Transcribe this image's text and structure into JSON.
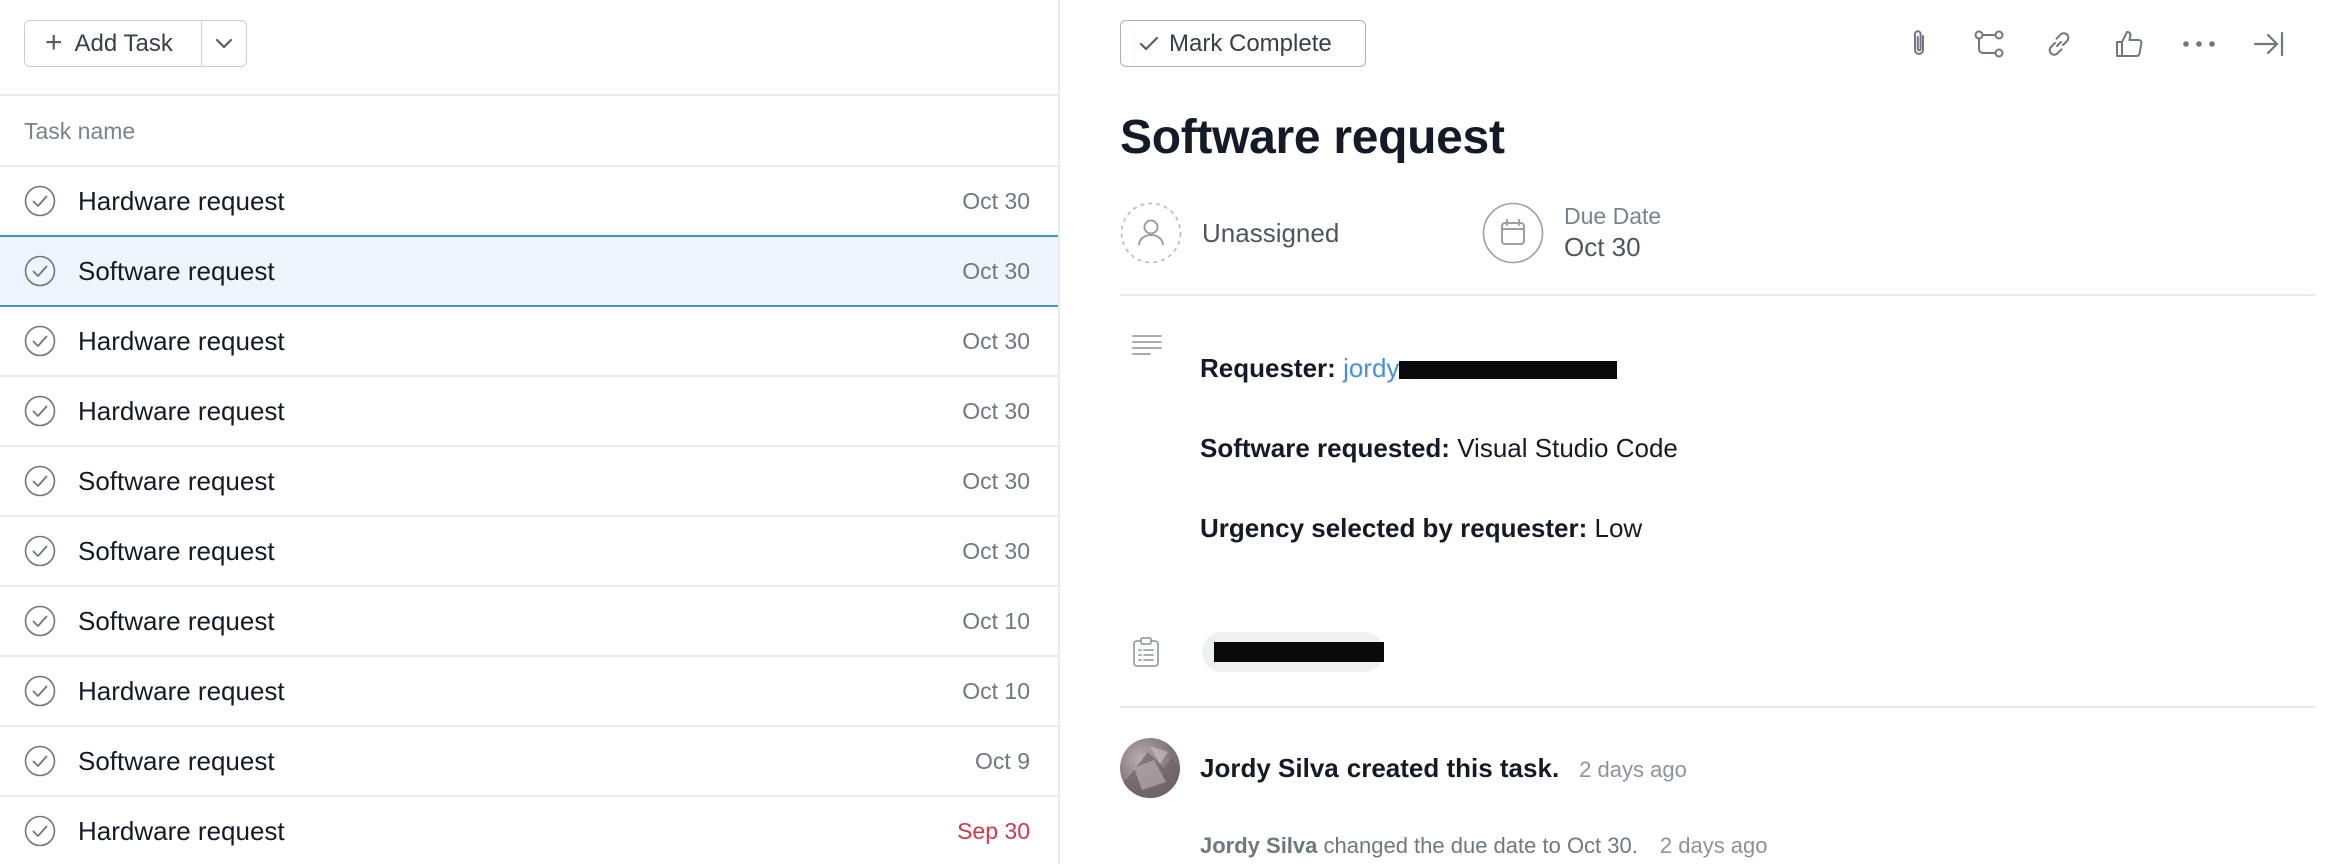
{
  "left": {
    "add_task_label": "Add Task",
    "column_header": "Task name",
    "tasks": [
      {
        "name": "Hardware request",
        "date": "Oct 30",
        "overdue": false,
        "selected": false
      },
      {
        "name": "Software request",
        "date": "Oct 30",
        "overdue": false,
        "selected": true
      },
      {
        "name": "Hardware request",
        "date": "Oct 30",
        "overdue": false,
        "selected": false
      },
      {
        "name": "Hardware request",
        "date": "Oct 30",
        "overdue": false,
        "selected": false
      },
      {
        "name": "Software request",
        "date": "Oct 30",
        "overdue": false,
        "selected": false
      },
      {
        "name": "Software request",
        "date": "Oct 30",
        "overdue": false,
        "selected": false
      },
      {
        "name": "Software request",
        "date": "Oct 10",
        "overdue": false,
        "selected": false
      },
      {
        "name": "Hardware request",
        "date": "Oct 10",
        "overdue": false,
        "selected": false
      },
      {
        "name": "Software request",
        "date": "Oct 9",
        "overdue": false,
        "selected": false
      },
      {
        "name": "Hardware request",
        "date": "Sep 30",
        "overdue": true,
        "selected": false
      }
    ]
  },
  "detail": {
    "mark_complete_label": "Mark Complete",
    "toolbar_icons": [
      "paperclip-icon",
      "subtask-icon",
      "link-icon",
      "thumbs-up-icon",
      "more-icon",
      "close-pane-icon"
    ],
    "title": "Software request",
    "assignee": "Unassigned",
    "due_label": "Due Date",
    "due_value": "Oct 30",
    "description": {
      "requester_label": "Requester:",
      "requester_email_visible": "jordy",
      "software_label": "Software requested:",
      "software_value": "Visual Studio Code",
      "urgency_label": "Urgency selected by requester:",
      "urgency_value": "Low"
    },
    "activity": [
      {
        "who": "Jordy Silva",
        "what": "created this task.",
        "when": "2 days ago"
      },
      {
        "who": "Jordy Silva",
        "what": "changed the due date to Oct 30.",
        "when": "2 days ago"
      }
    ]
  },
  "colors": {
    "accent_blue": "#4a90d9",
    "selected_row_bg": "#edf5fd",
    "overdue_red": "#d1394a",
    "text_primary": "#151b26",
    "text_secondary": "#6f7782"
  }
}
